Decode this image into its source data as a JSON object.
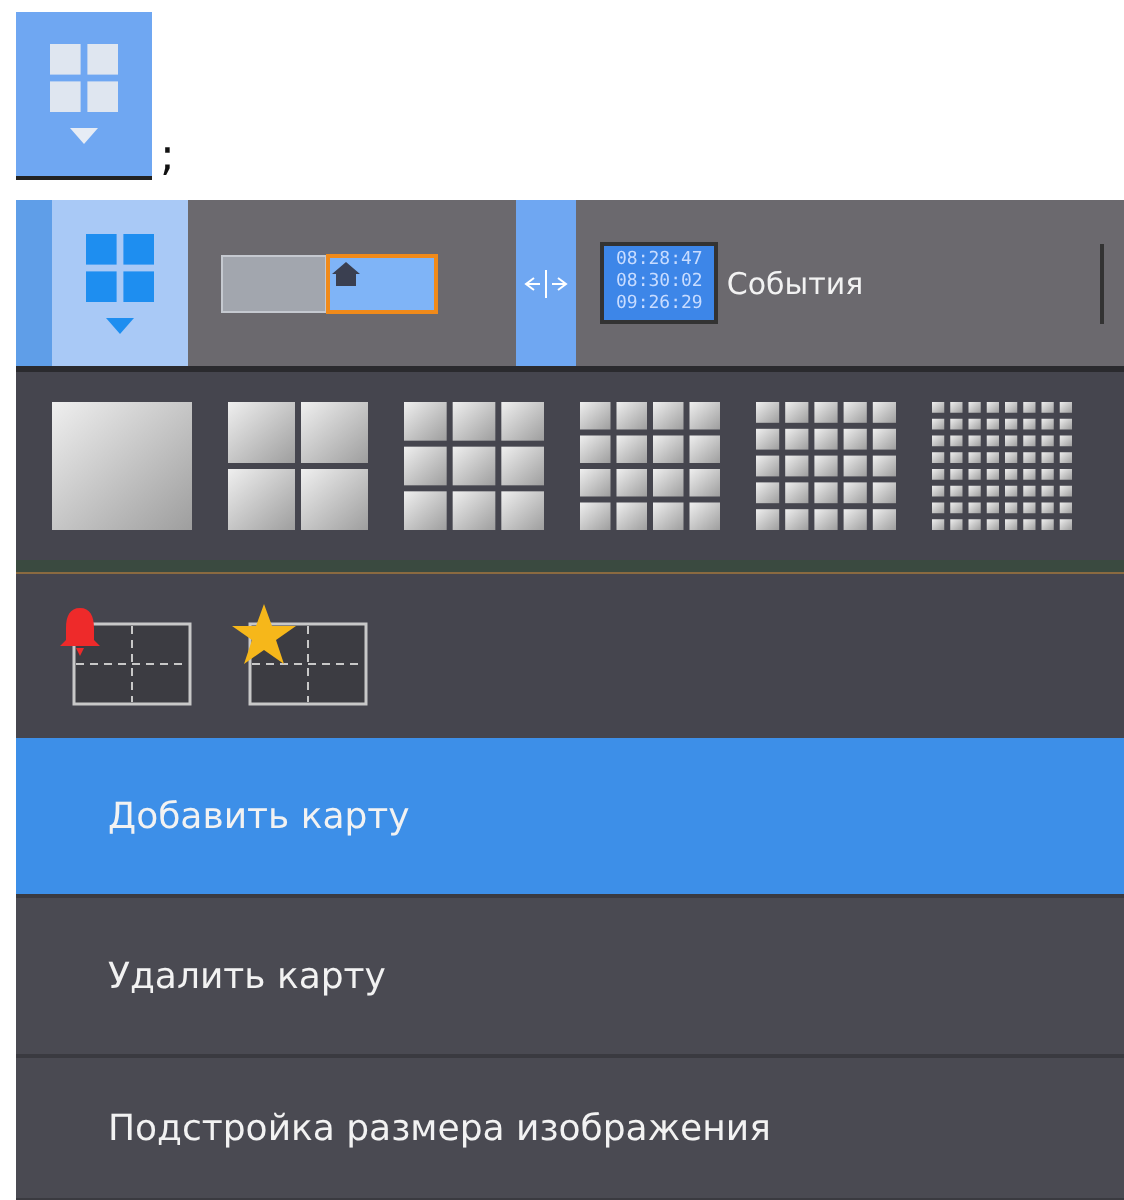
{
  "inline_icon": {
    "trailing": ";"
  },
  "toolbar": {
    "times": [
      "08:28:47",
      "08:30:02",
      "09:26:29"
    ],
    "events_label": "События"
  },
  "layouts": [
    {
      "kind": "single"
    },
    {
      "kind": "quad"
    },
    {
      "kind": "nine"
    },
    {
      "kind": "sixteen"
    },
    {
      "kind": "twentyfive"
    },
    {
      "kind": "sixtyfour"
    }
  ],
  "special_layouts": [
    {
      "kind": "alarm"
    },
    {
      "kind": "favorite"
    }
  ],
  "menu": [
    {
      "label": "Добавить карту",
      "selected": true
    },
    {
      "label": "Удалить карту",
      "selected": false
    },
    {
      "label": "Подстройка размера изображения",
      "selected": false
    }
  ]
}
